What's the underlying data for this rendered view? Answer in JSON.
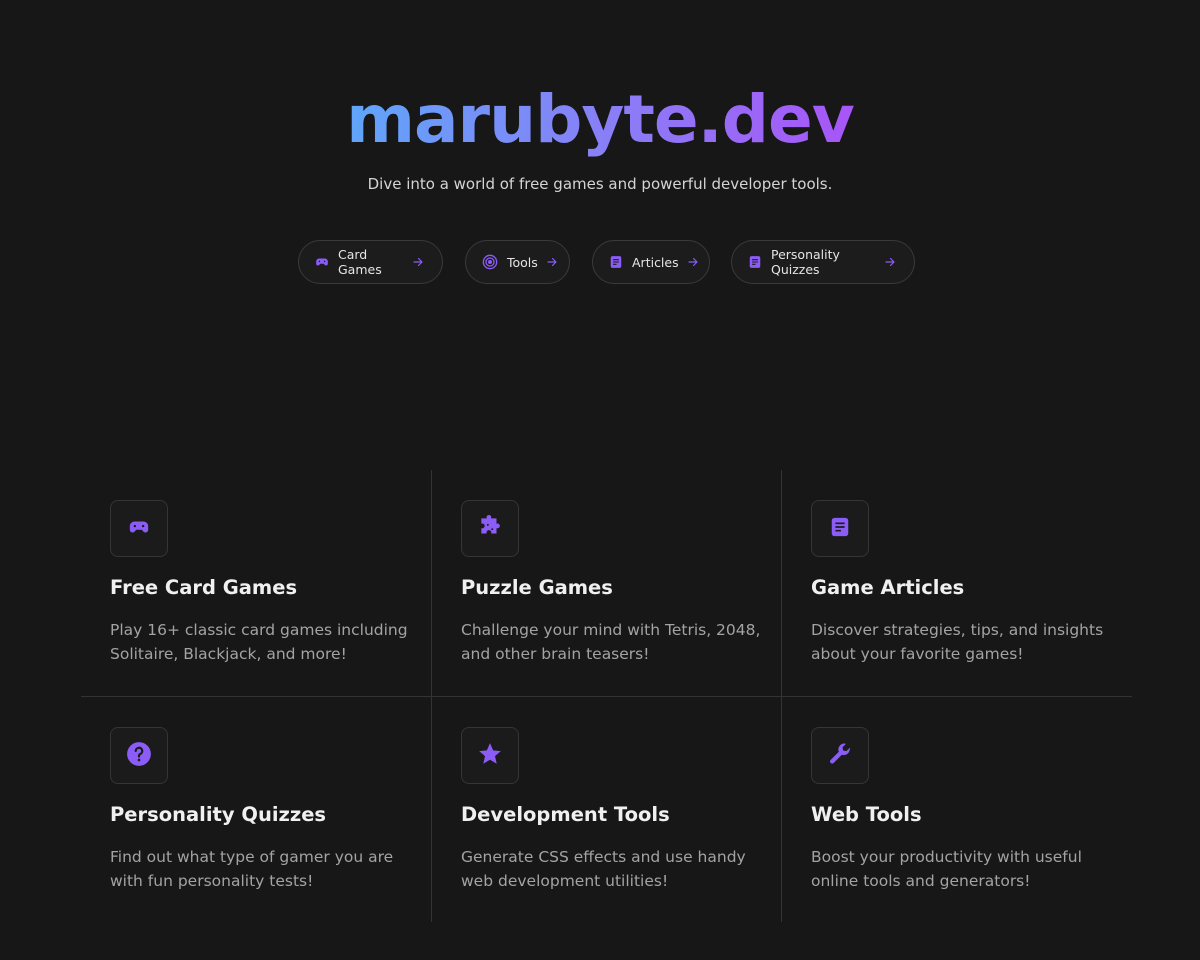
{
  "hero": {
    "brand": "marubyte.dev",
    "tagline": "Dive into a world of free games and powerful developer tools."
  },
  "nav_pills": [
    {
      "label": "Card Games",
      "icon": "gamepad-icon"
    },
    {
      "label": "Tools",
      "icon": "target-icon"
    },
    {
      "label": "Articles",
      "icon": "document-icon"
    },
    {
      "label": "Personality Quizzes",
      "icon": "document-icon"
    }
  ],
  "features": [
    {
      "title": "Free Card Games",
      "description": "Play 16+ classic card games including Solitaire, Blackjack, and more!",
      "icon": "gamepad-icon"
    },
    {
      "title": "Puzzle Games",
      "description": "Challenge your mind with Tetris, 2048, and other brain teasers!",
      "icon": "puzzle-icon"
    },
    {
      "title": "Game Articles",
      "description": "Discover strategies, tips, and insights about your favorite games!",
      "icon": "document-icon"
    },
    {
      "title": "Personality Quizzes",
      "description": "Find out what type of gamer you are with fun personality tests!",
      "icon": "question-icon"
    },
    {
      "title": "Development Tools",
      "description": "Generate CSS effects and use handy web development utilities!",
      "icon": "star-icon"
    },
    {
      "title": "Web Tools",
      "description": "Boost your productivity with useful online tools and generators!",
      "icon": "wrench-icon"
    }
  ],
  "colors": {
    "background": "#171717",
    "accent": "#8b5cf6",
    "brand_gradient_start": "#60a5fa",
    "brand_gradient_end": "#a855f7"
  }
}
